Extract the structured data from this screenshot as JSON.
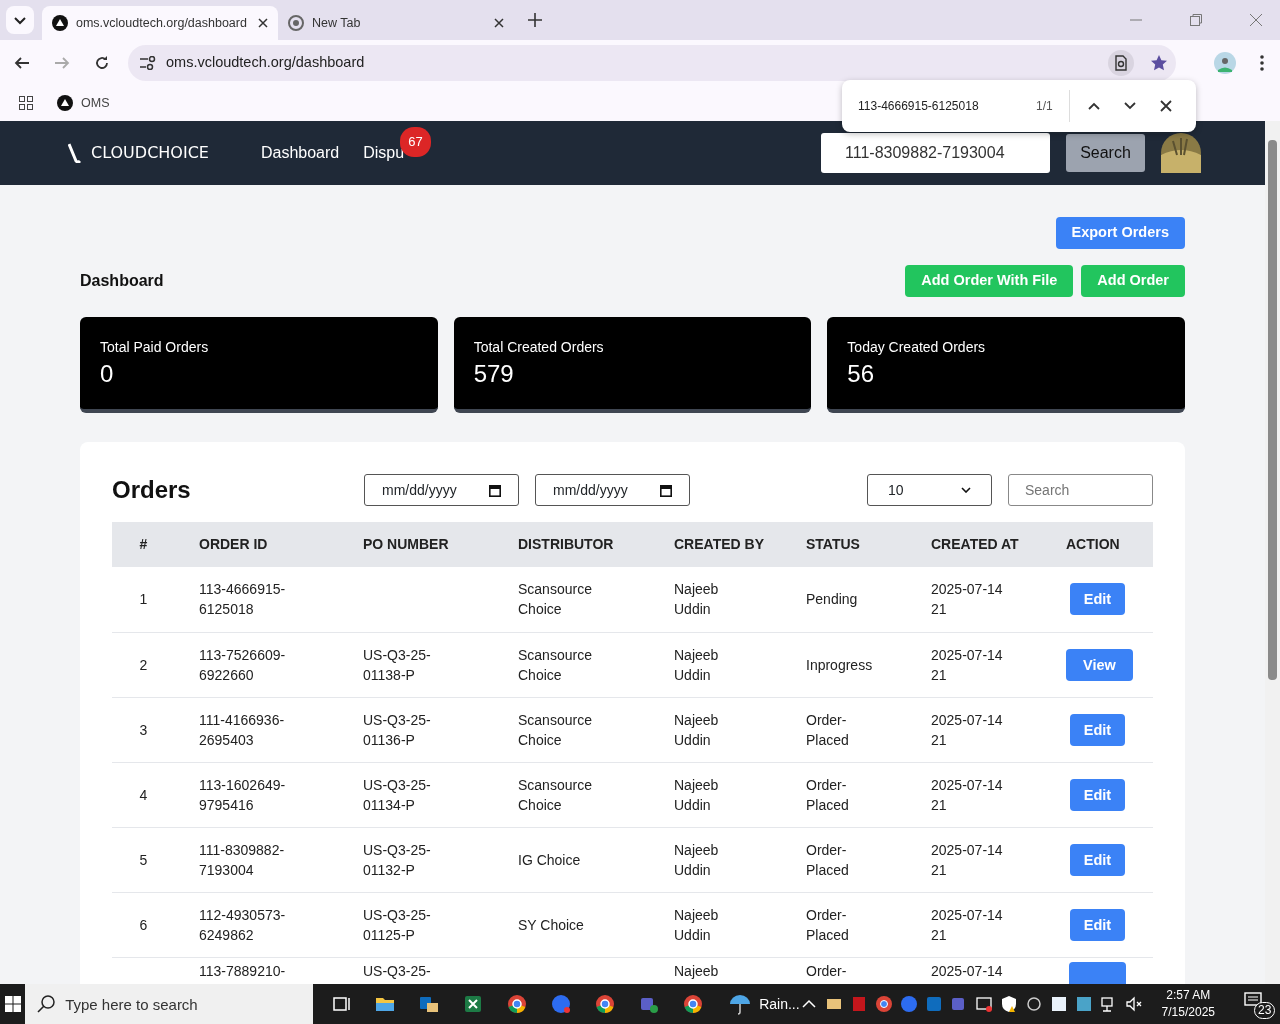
{
  "browser": {
    "tabs": [
      {
        "title": "oms.vcloudtech.org/dashboard",
        "selected": true
      },
      {
        "title": "New Tab",
        "selected": false
      }
    ],
    "address": "oms.vcloudtech.org/dashboard",
    "bookmarks": [
      {
        "label": "OMS"
      }
    ],
    "find_bar": {
      "query": "113-4666915-6125018",
      "count": "1/1"
    }
  },
  "navbar": {
    "logo": "CLOUDCHOICE",
    "links": [
      {
        "label": "Dashboard"
      },
      {
        "label": "Dispu",
        "badge": "67"
      }
    ],
    "search": {
      "value": "111-8309882-7193004"
    },
    "search_button": "Search"
  },
  "header": {
    "title": "Dashboard",
    "buttons": [
      {
        "label": "Export Orders",
        "kind": "primary"
      },
      {
        "label": "Add Order With File",
        "kind": "success"
      },
      {
        "label": "Add Order",
        "kind": "success"
      }
    ]
  },
  "stats": [
    {
      "label": "Total Paid Orders",
      "value": "0"
    },
    {
      "label": "Total Created Orders",
      "value": "579"
    },
    {
      "label": "Today Created Orders",
      "value": "56"
    }
  ],
  "orders": {
    "title": "Orders",
    "date_from": "mm/dd/yyyy",
    "date_to": "mm/dd/yyyy",
    "page_size": "10",
    "search": {
      "placeholder": "Search"
    },
    "columns": [
      "#",
      "ORDER ID",
      "PO NUMBER",
      "DISTRIBUTOR",
      "CREATED BY",
      "STATUS",
      "CREATED AT",
      "ACTION"
    ],
    "rows": [
      {
        "index": "1",
        "order_id": "113-4666915-6125018",
        "distributor": "Scansource Choice",
        "created_by": "Najeeb Uddin",
        "status": "Pending",
        "created_at": "2025-07-14 21",
        "action": {
          "kind": "edit",
          "label": "Edit"
        }
      },
      {
        "index": "2",
        "order_id": "113-7526609-6922660",
        "po_number": "US-Q3-25-01138-P",
        "distributor": "Scansource Choice",
        "created_by": "Najeeb Uddin",
        "status": "Inprogress",
        "created_at": "2025-07-14 21",
        "action": {
          "kind": "view",
          "label": "View"
        }
      },
      {
        "index": "3",
        "order_id": "111-4166936-2695403",
        "po_number": "US-Q3-25-01136-P",
        "distributor": "Scansource Choice",
        "created_by": "Najeeb Uddin",
        "status": "Order-Placed",
        "created_at": "2025-07-14 21",
        "action": {
          "kind": "edit",
          "label": "Edit"
        }
      },
      {
        "index": "4",
        "order_id": "113-1602649-9795416",
        "po_number": "US-Q3-25-01134-P",
        "distributor": "Scansource Choice",
        "created_by": "Najeeb Uddin",
        "status": "Order-Placed",
        "created_at": "2025-07-14 21",
        "action": {
          "kind": "edit",
          "label": "Edit"
        }
      },
      {
        "index": "5",
        "order_id": "111-8309882-7193004",
        "po_number": "US-Q3-25-01132-P",
        "distributor": "IG Choice",
        "created_by": "Najeeb Uddin",
        "status": "Order-Placed",
        "created_at": "2025-07-14 21",
        "action": {
          "kind": "edit",
          "label": "Edit"
        }
      },
      {
        "index": "6",
        "order_id": "112-4930573-6249862",
        "po_number": "US-Q3-25-01125-P",
        "distributor": "SY Choice",
        "created_by": "Najeeb Uddin",
        "status": "Order-Placed",
        "created_at": "2025-07-14 21",
        "action": {
          "kind": "edit",
          "label": "Edit"
        }
      },
      {
        "order_id": "113-7889210-",
        "po_number": "US-Q3-25-",
        "created_by": "Najeeb",
        "status": "Order-",
        "created_at": "2025-07-14",
        "action": {
          "kind": "edit"
        }
      }
    ]
  },
  "taskbar": {
    "search": {
      "placeholder": "Type here to search"
    },
    "weather": "Rain...",
    "time": "2:57 AM",
    "date": "7/15/2025",
    "notifications": "23"
  }
}
